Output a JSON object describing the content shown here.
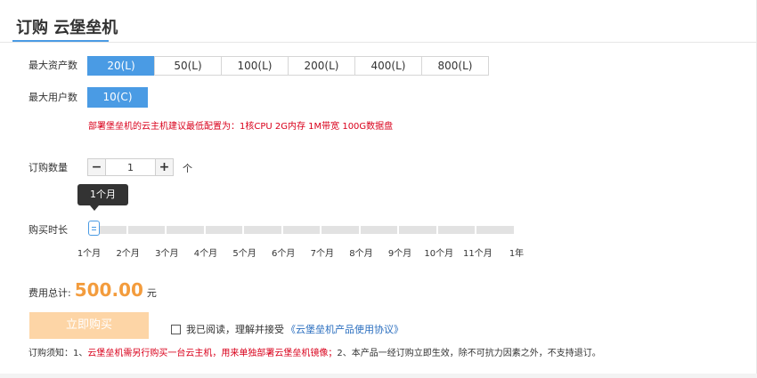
{
  "header": {
    "title": "订购 云堡垒机"
  },
  "assets": {
    "label": "最大资产数",
    "options": [
      "20(L)",
      "50(L)",
      "100(L)",
      "200(L)",
      "400(L)",
      "800(L)"
    ],
    "selected": "20(L)"
  },
  "users": {
    "label": "最大用户数",
    "value": "10(C)"
  },
  "warning": "部署堡垒机的云主机建议最低配置为：1核CPU 2G内存 1M带宽 100G数据盘",
  "quantity": {
    "label": "订购数量",
    "value": "1",
    "minus": "−",
    "plus": "+",
    "unit": "个"
  },
  "duration": {
    "label": "购买时长",
    "tooltip": "1个月",
    "selected_index": 0,
    "ticks": [
      "1个月",
      "2个月",
      "3个月",
      "4个月",
      "5个月",
      "6个月",
      "7个月",
      "8个月",
      "9个月",
      "10个月",
      "11个月",
      "1年"
    ]
  },
  "total": {
    "label": "费用总计:",
    "price": "500.00",
    "unit": "元"
  },
  "buy_button": "立即购买",
  "agreement": {
    "text": "我已阅读，理解并接受",
    "link": "《云堡垒机产品使用协议》",
    "checked": false
  },
  "notice": {
    "prefix": "订购须知：1、",
    "red": "云堡垒机需另行购买一台云主机，用来单独部署云堡垒机镜像；",
    "suffix": "2、本产品一经订购立即生效，除不可抗力因素之外，不支持退订。"
  },
  "colors": {
    "accent": "#4a9be4",
    "price": "#f39c3d",
    "warning": "#d9001b",
    "buy_disabled": "#fdd5a6"
  }
}
